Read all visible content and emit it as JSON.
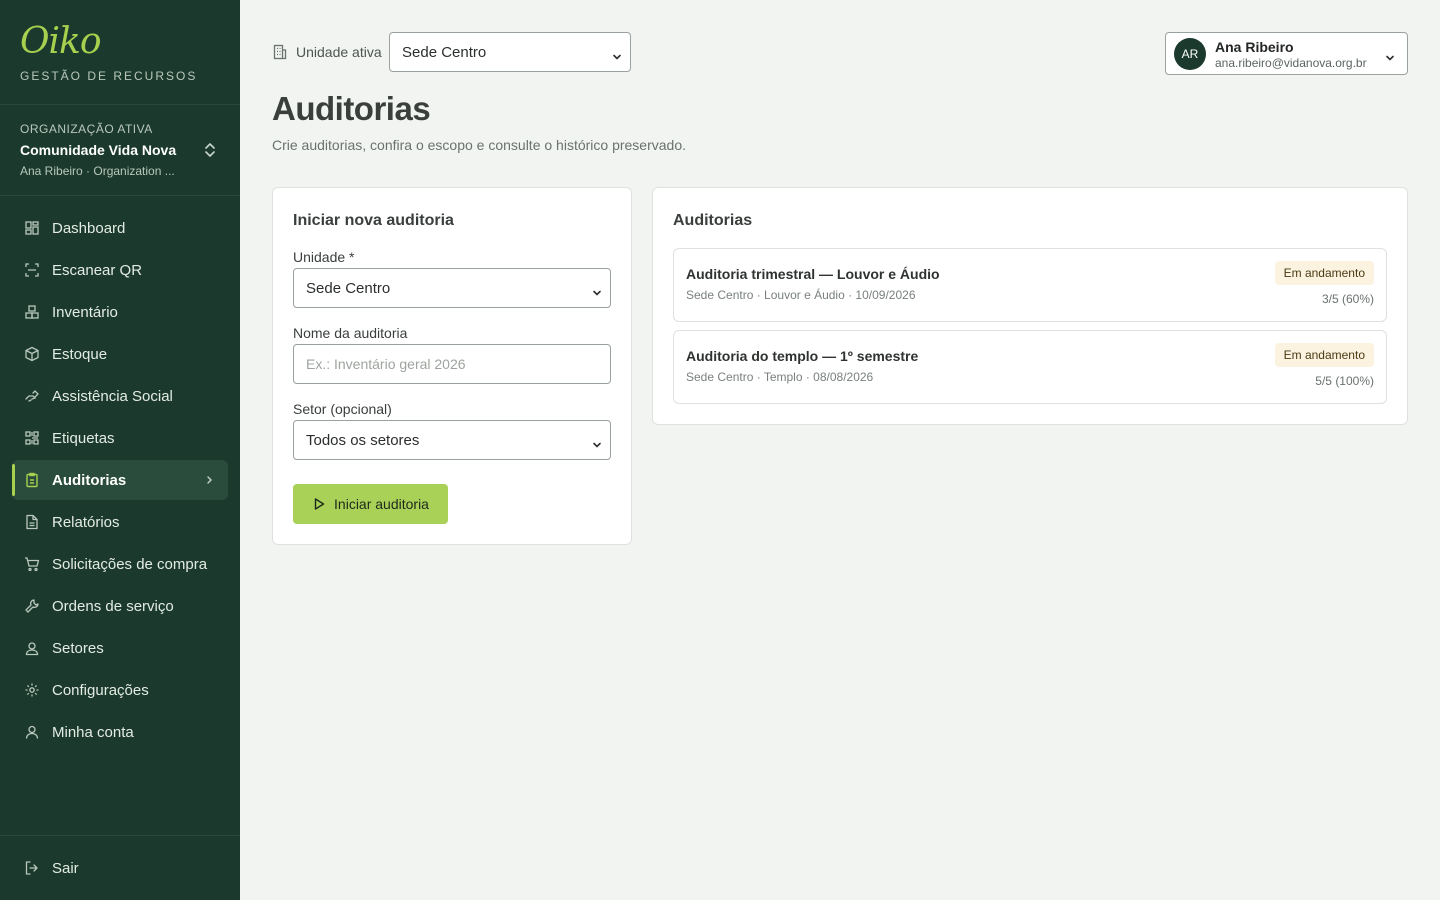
{
  "sidebar": {
    "logo": "Oiko",
    "brand_subtitle": "GESTÃO DE RECURSOS",
    "org": {
      "caption": "ORGANIZAÇÃO ATIVA",
      "name": "Comunidade Vida Nova",
      "user_line": "Ana Ribeiro · Organization ..."
    },
    "items": [
      {
        "label": "Dashboard",
        "icon": "dashboard-icon"
      },
      {
        "label": "Escanear QR",
        "icon": "scan-icon"
      },
      {
        "label": "Inventário",
        "icon": "boxes-icon"
      },
      {
        "label": "Estoque",
        "icon": "package-icon"
      },
      {
        "label": "Assistência Social",
        "icon": "hand-icon"
      },
      {
        "label": "Etiquetas",
        "icon": "qr-code-icon"
      },
      {
        "label": "Auditorias",
        "icon": "clipboard-check-icon",
        "active": true
      },
      {
        "label": "Relatórios",
        "icon": "file-icon"
      },
      {
        "label": "Solicitações de compra",
        "icon": "cart-icon"
      },
      {
        "label": "Ordens de serviço",
        "icon": "wrench-icon"
      },
      {
        "label": "Setores",
        "icon": "contact-icon"
      },
      {
        "label": "Configurações",
        "icon": "gear-icon"
      },
      {
        "label": "Minha conta",
        "icon": "user-icon"
      }
    ],
    "logout_label": "Sair"
  },
  "topbar": {
    "unit_label": "Unidade ativa",
    "unit_value": "Sede Centro",
    "user": {
      "initials": "AR",
      "name": "Ana Ribeiro",
      "email": "ana.ribeiro@vidanova.org.br"
    }
  },
  "page": {
    "title": "Auditorias",
    "subtitle": "Crie auditorias, confira o escopo e consulte o histórico preservado."
  },
  "new_audit": {
    "title": "Iniciar nova auditoria",
    "unit_label": "Unidade *",
    "unit_value": "Sede Centro",
    "name_label": "Nome da auditoria",
    "name_placeholder": "Ex.: Inventário geral 2026",
    "sector_label": "Setor (opcional)",
    "sector_value": "Todos os setores",
    "start_button": "Iniciar auditoria"
  },
  "audits": {
    "title": "Auditorias",
    "items": [
      {
        "title": "Auditoria trimestral — Louvor e Áudio",
        "meta": "Sede Centro · Louvor e Áudio · 10/09/2026",
        "status": "Em andamento",
        "progress": "3/5 (60%)"
      },
      {
        "title": "Auditoria do templo — 1º semestre",
        "meta": "Sede Centro · Templo · 08/08/2026",
        "status": "Em andamento",
        "progress": "5/5 (100%)"
      }
    ]
  },
  "colors": {
    "sidebar_bg": "#1b3a2d",
    "accent": "#a7d04f",
    "page_bg": "#f2f4f1",
    "badge_bg": "#fbf3e0"
  }
}
